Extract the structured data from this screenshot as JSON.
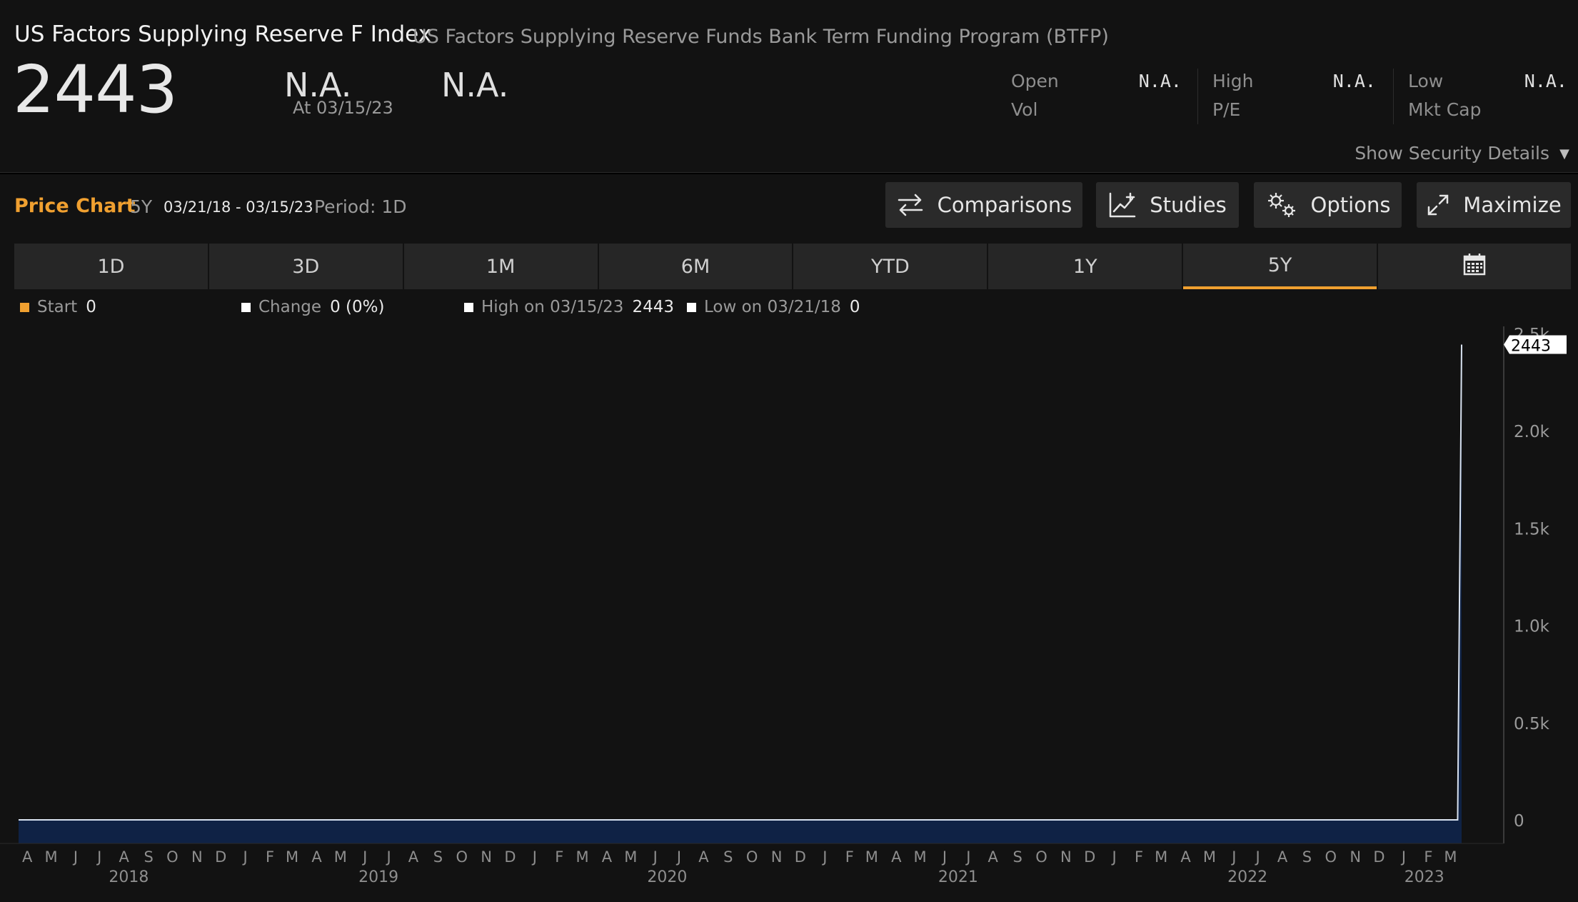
{
  "header": {
    "title": "US Factors Supplying Reserve F Index",
    "subtitle": "US Factors Supplying Reserve Funds Bank Term Funding Program (BTFP)",
    "price": "2443",
    "change_net": "N.A.",
    "as_of": "At 03/15/23",
    "change_pct": "N.A."
  },
  "stats": {
    "open_label": "Open",
    "open_value": "N.A.",
    "vol_label": "Vol",
    "high_label": "High",
    "high_value": "N.A.",
    "pe_label": "P/E",
    "low_label": "Low",
    "low_value": "N.A.",
    "mktcap_label": "Mkt Cap"
  },
  "show_details": "Show Security Details",
  "toolbar": {
    "chart_label": "Price Chart",
    "range": "5Y",
    "dates": "03/21/18 - 03/15/23",
    "period": "Period: 1D",
    "comparisons": "Comparisons",
    "studies": "Studies",
    "options": "Options",
    "maximize": "Maximize"
  },
  "tabs": [
    "1D",
    "3D",
    "1M",
    "6M",
    "YTD",
    "1Y",
    "5Y"
  ],
  "active_tab": "5Y",
  "legend": {
    "start_label": "Start",
    "start_value": "0",
    "change_label": "Change",
    "change_value": "0 (0%)",
    "high_label": "High on 03/15/23",
    "high_value": "2443",
    "low_label": "Low on 03/21/18",
    "low_value": "0"
  },
  "colors": {
    "accent": "#f0a030",
    "fill": "#0f2245",
    "line": "#d8e2f0",
    "background": "#121212"
  },
  "icons": [
    "arrows-swap-icon",
    "chart-plus-icon",
    "gears-icon",
    "expand-icon",
    "calendar-icon",
    "triangle-down-icon"
  ],
  "chart_data": {
    "type": "area",
    "x": [
      "2018-03-21",
      "2023-03-10",
      "2023-03-15"
    ],
    "y": [
      0,
      0,
      2443
    ],
    "last_value_label": "2443",
    "ylim": [
      0,
      2500
    ],
    "yticks": [
      "0",
      "0.5k",
      "1.0k",
      "1.5k",
      "2.0k",
      "2.5k"
    ],
    "ytick_values": [
      0,
      500,
      1000,
      1500,
      2000,
      2500
    ],
    "month_labels": [
      "A",
      "M",
      "J",
      "J",
      "A",
      "S",
      "O",
      "N",
      "D",
      "J",
      "F",
      "M",
      "A",
      "M",
      "J",
      "J",
      "A",
      "S",
      "O",
      "N",
      "D",
      "J",
      "F",
      "M",
      "A",
      "M",
      "J",
      "J",
      "A",
      "S",
      "O",
      "N",
      "D",
      "J",
      "F",
      "M",
      "A",
      "M",
      "J",
      "J",
      "A",
      "S",
      "O",
      "N",
      "D",
      "J",
      "F",
      "M",
      "A",
      "M",
      "J",
      "J",
      "A",
      "S",
      "O",
      "N",
      "D",
      "J",
      "F",
      "M"
    ],
    "month_dates": [
      "2018-04-01",
      "2018-05-01",
      "2018-06-01",
      "2018-07-01",
      "2018-08-01",
      "2018-09-01",
      "2018-10-01",
      "2018-11-01",
      "2018-12-01",
      "2019-01-01",
      "2019-02-01",
      "2019-03-01",
      "2019-04-01",
      "2019-05-01",
      "2019-06-01",
      "2019-07-01",
      "2019-08-01",
      "2019-09-01",
      "2019-10-01",
      "2019-11-01",
      "2019-12-01",
      "2020-01-01",
      "2020-02-01",
      "2020-03-01",
      "2020-04-01",
      "2020-05-01",
      "2020-06-01",
      "2020-07-01",
      "2020-08-01",
      "2020-09-01",
      "2020-10-01",
      "2020-11-01",
      "2020-12-01",
      "2021-01-01",
      "2021-02-01",
      "2021-03-01",
      "2021-04-01",
      "2021-05-01",
      "2021-06-01",
      "2021-07-01",
      "2021-08-01",
      "2021-09-01",
      "2021-10-01",
      "2021-11-01",
      "2021-12-01",
      "2022-01-01",
      "2022-02-01",
      "2022-03-01",
      "2022-04-01",
      "2022-05-01",
      "2022-06-01",
      "2022-07-01",
      "2022-08-01",
      "2022-09-01",
      "2022-10-01",
      "2022-11-01",
      "2022-12-01",
      "2023-01-01",
      "2023-02-01",
      "2023-03-01"
    ],
    "year_labels": [
      "2018",
      "2019",
      "2020",
      "2021",
      "2022",
      "2023"
    ],
    "year_dates": [
      "2018-08-07",
      "2019-06-18",
      "2020-06-16",
      "2021-06-18",
      "2022-06-18",
      "2023-01-27"
    ],
    "grid": false,
    "title": "",
    "xlabel": "",
    "ylabel": ""
  }
}
